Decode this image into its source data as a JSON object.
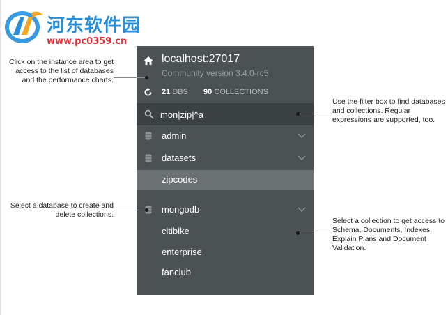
{
  "watermark": {
    "title": "河东软件园",
    "url": "www.pc0359.cn"
  },
  "sidebar": {
    "instance": {
      "host": "localhost:27017",
      "version": "Community version 3.4.0-rc5",
      "dbs_count": "21",
      "dbs_label": "DBS",
      "collections_count": "90",
      "collections_label": "COLLECTIONS"
    },
    "filter": {
      "value": "mon|zip|^a"
    },
    "databases": [
      {
        "name": "admin",
        "expanded": false
      },
      {
        "name": "datasets",
        "expanded": true,
        "collections": [
          "zipcodes"
        ],
        "selected_collection": "zipcodes"
      },
      {
        "name": "mongodb",
        "expanded": true,
        "collections": [
          "citibike",
          "enterprise",
          "fanclub"
        ]
      }
    ]
  },
  "annotations": {
    "instance": "Click on the instance area to get access to the list of databases and the performance charts.",
    "filter": "Use the filter box to find databases and collections. Regular expressions are supported, too.",
    "database": "Select a database to create and delete collections.",
    "collection": "Select a collection to get access to Schema, Documents, Indexes, Explain Plans and Document Validation."
  },
  "colors": {
    "sidebar_bg": "#4c5153",
    "filter_bg": "#3c4143",
    "selected_bg": "#6c7173",
    "watermark_blue": "#2a8fd8",
    "watermark_red": "#e0303a"
  },
  "icons": [
    "home-icon",
    "refresh-icon",
    "search-icon",
    "database-icon",
    "chevron-down-icon",
    "logo-icon"
  ]
}
